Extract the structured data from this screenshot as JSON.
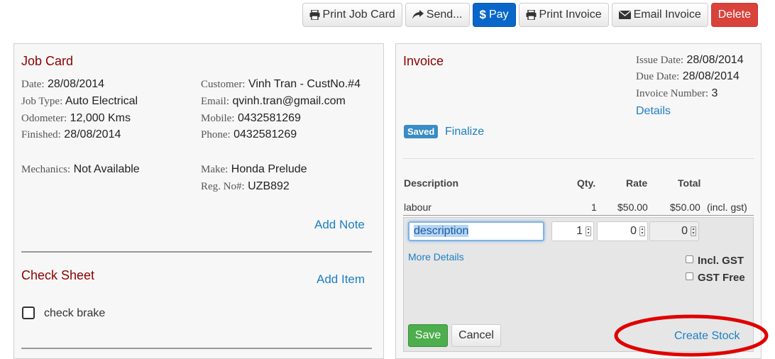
{
  "toolbar": {
    "print_job_card": "Print Job Card",
    "send": "Send...",
    "pay": "Pay",
    "print_invoice": "Print Invoice",
    "email_invoice": "Email Invoice",
    "delete": "Delete"
  },
  "job_card": {
    "title": "Job Card",
    "date_label": "Date:",
    "date_value": "28/08/2014",
    "job_type_label": "Job Type:",
    "job_type_value": "Auto Electrical",
    "odometer_label": "Odometer:",
    "odometer_value": "12,000 Kms",
    "finished_label": "Finished:",
    "finished_value": "28/08/2014",
    "customer_label": "Customer:",
    "customer_value": "Vinh Tran - CustNo.#4",
    "email_label": "Email:",
    "email_value": "qvinh.tran@gmail.com",
    "mobile_label": "Mobile:",
    "mobile_value": "0432581269",
    "phone_label": "Phone:",
    "phone_value": "0432581269",
    "mechanics_label": "Mechanics:",
    "mechanics_value": "Not Available",
    "make_label": "Make:",
    "make_value": "Honda Prelude",
    "reg_label": "Reg. No#:",
    "reg_value": "UZB892",
    "add_note": "Add Note"
  },
  "check_sheet": {
    "title": "Check Sheet",
    "add_item": "Add Item",
    "items": [
      "check brake"
    ]
  },
  "invoice": {
    "title": "Invoice",
    "issue_date_label": "Issue Date:",
    "issue_date_value": "28/08/2014",
    "due_date_label": "Due Date:",
    "due_date_value": "28/08/2014",
    "invoice_number_label": "Invoice Number:",
    "invoice_number_value": "3",
    "details": "Details",
    "status_badge": "Saved",
    "finalize": "Finalize",
    "columns": [
      "Description",
      "Qty.",
      "Rate",
      "Total"
    ],
    "rows": [
      {
        "description": "labour",
        "qty": "1",
        "rate": "$50.00",
        "total": "$50.00",
        "note": "(incl. gst)"
      }
    ],
    "new_line": {
      "description": "description",
      "qty": "1",
      "rate": "0",
      "total": "0"
    },
    "more_details": "More Details",
    "incl_gst": "Incl. GST",
    "gst_free": "GST Free",
    "save": "Save",
    "cancel": "Cancel",
    "create_stock": "Create Stock"
  },
  "colors": {
    "primary": "#0a67c9",
    "danger": "#d9433c",
    "success": "#4cae4c",
    "heading": "#8b0000",
    "link": "#1c7ec4",
    "annotation": "#e00000"
  },
  "icons": [
    "printer-icon",
    "share-arrow-icon",
    "dollar-icon",
    "printer-icon",
    "envelope-icon"
  ]
}
